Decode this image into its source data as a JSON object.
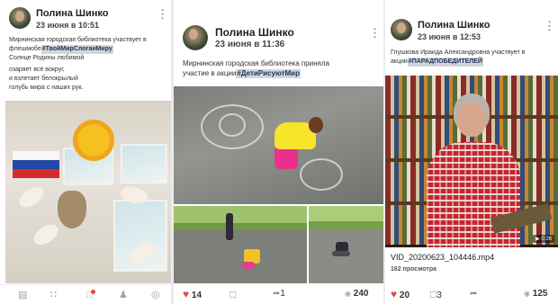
{
  "posts": [
    {
      "author": "Полина Шинко",
      "date": "23 июня в 10:51",
      "text_lines": [
        "Мирнинская городская библиотека участвует в",
        "флешмобе",
        "Солнце Родины любимой",
        "озаряет всё вокруг,",
        "и взлетает белокрылый",
        "голубь мира с наших рук."
      ],
      "hashtag": "#ТвойМирСлоганМиру"
    },
    {
      "author": "Полина Шинко",
      "date": "23 июня в 11:36",
      "text_lines": [
        "Мирнинская городская библиотека приняла",
        "участие в акции"
      ],
      "hashtag": "#ДетиРисуютМир",
      "likes": "14",
      "reposts": "1",
      "views": "240"
    },
    {
      "author": "Полина Шинко",
      "date": "23 июня в 12:53",
      "text_lines": [
        "Глушкова Ираида Александровна участвует в",
        "акции"
      ],
      "hashtag": "#ПАРАДПОБЕДИТЕЛЕЙ",
      "video_duration": "0:26",
      "file_name": "VID_20200623_104446.mp4",
      "video_views": "162 просмотра",
      "likes": "20",
      "comments": "3",
      "views": "125"
    }
  ],
  "nav": {
    "icons": [
      "news-icon",
      "services-icon",
      "messages-icon",
      "friends-icon",
      "profile-icon"
    ],
    "accent": "#3f8ae0",
    "badge_color": "#e64646"
  },
  "colors": {
    "like": "#e64646",
    "icon": "#8c96a1"
  }
}
